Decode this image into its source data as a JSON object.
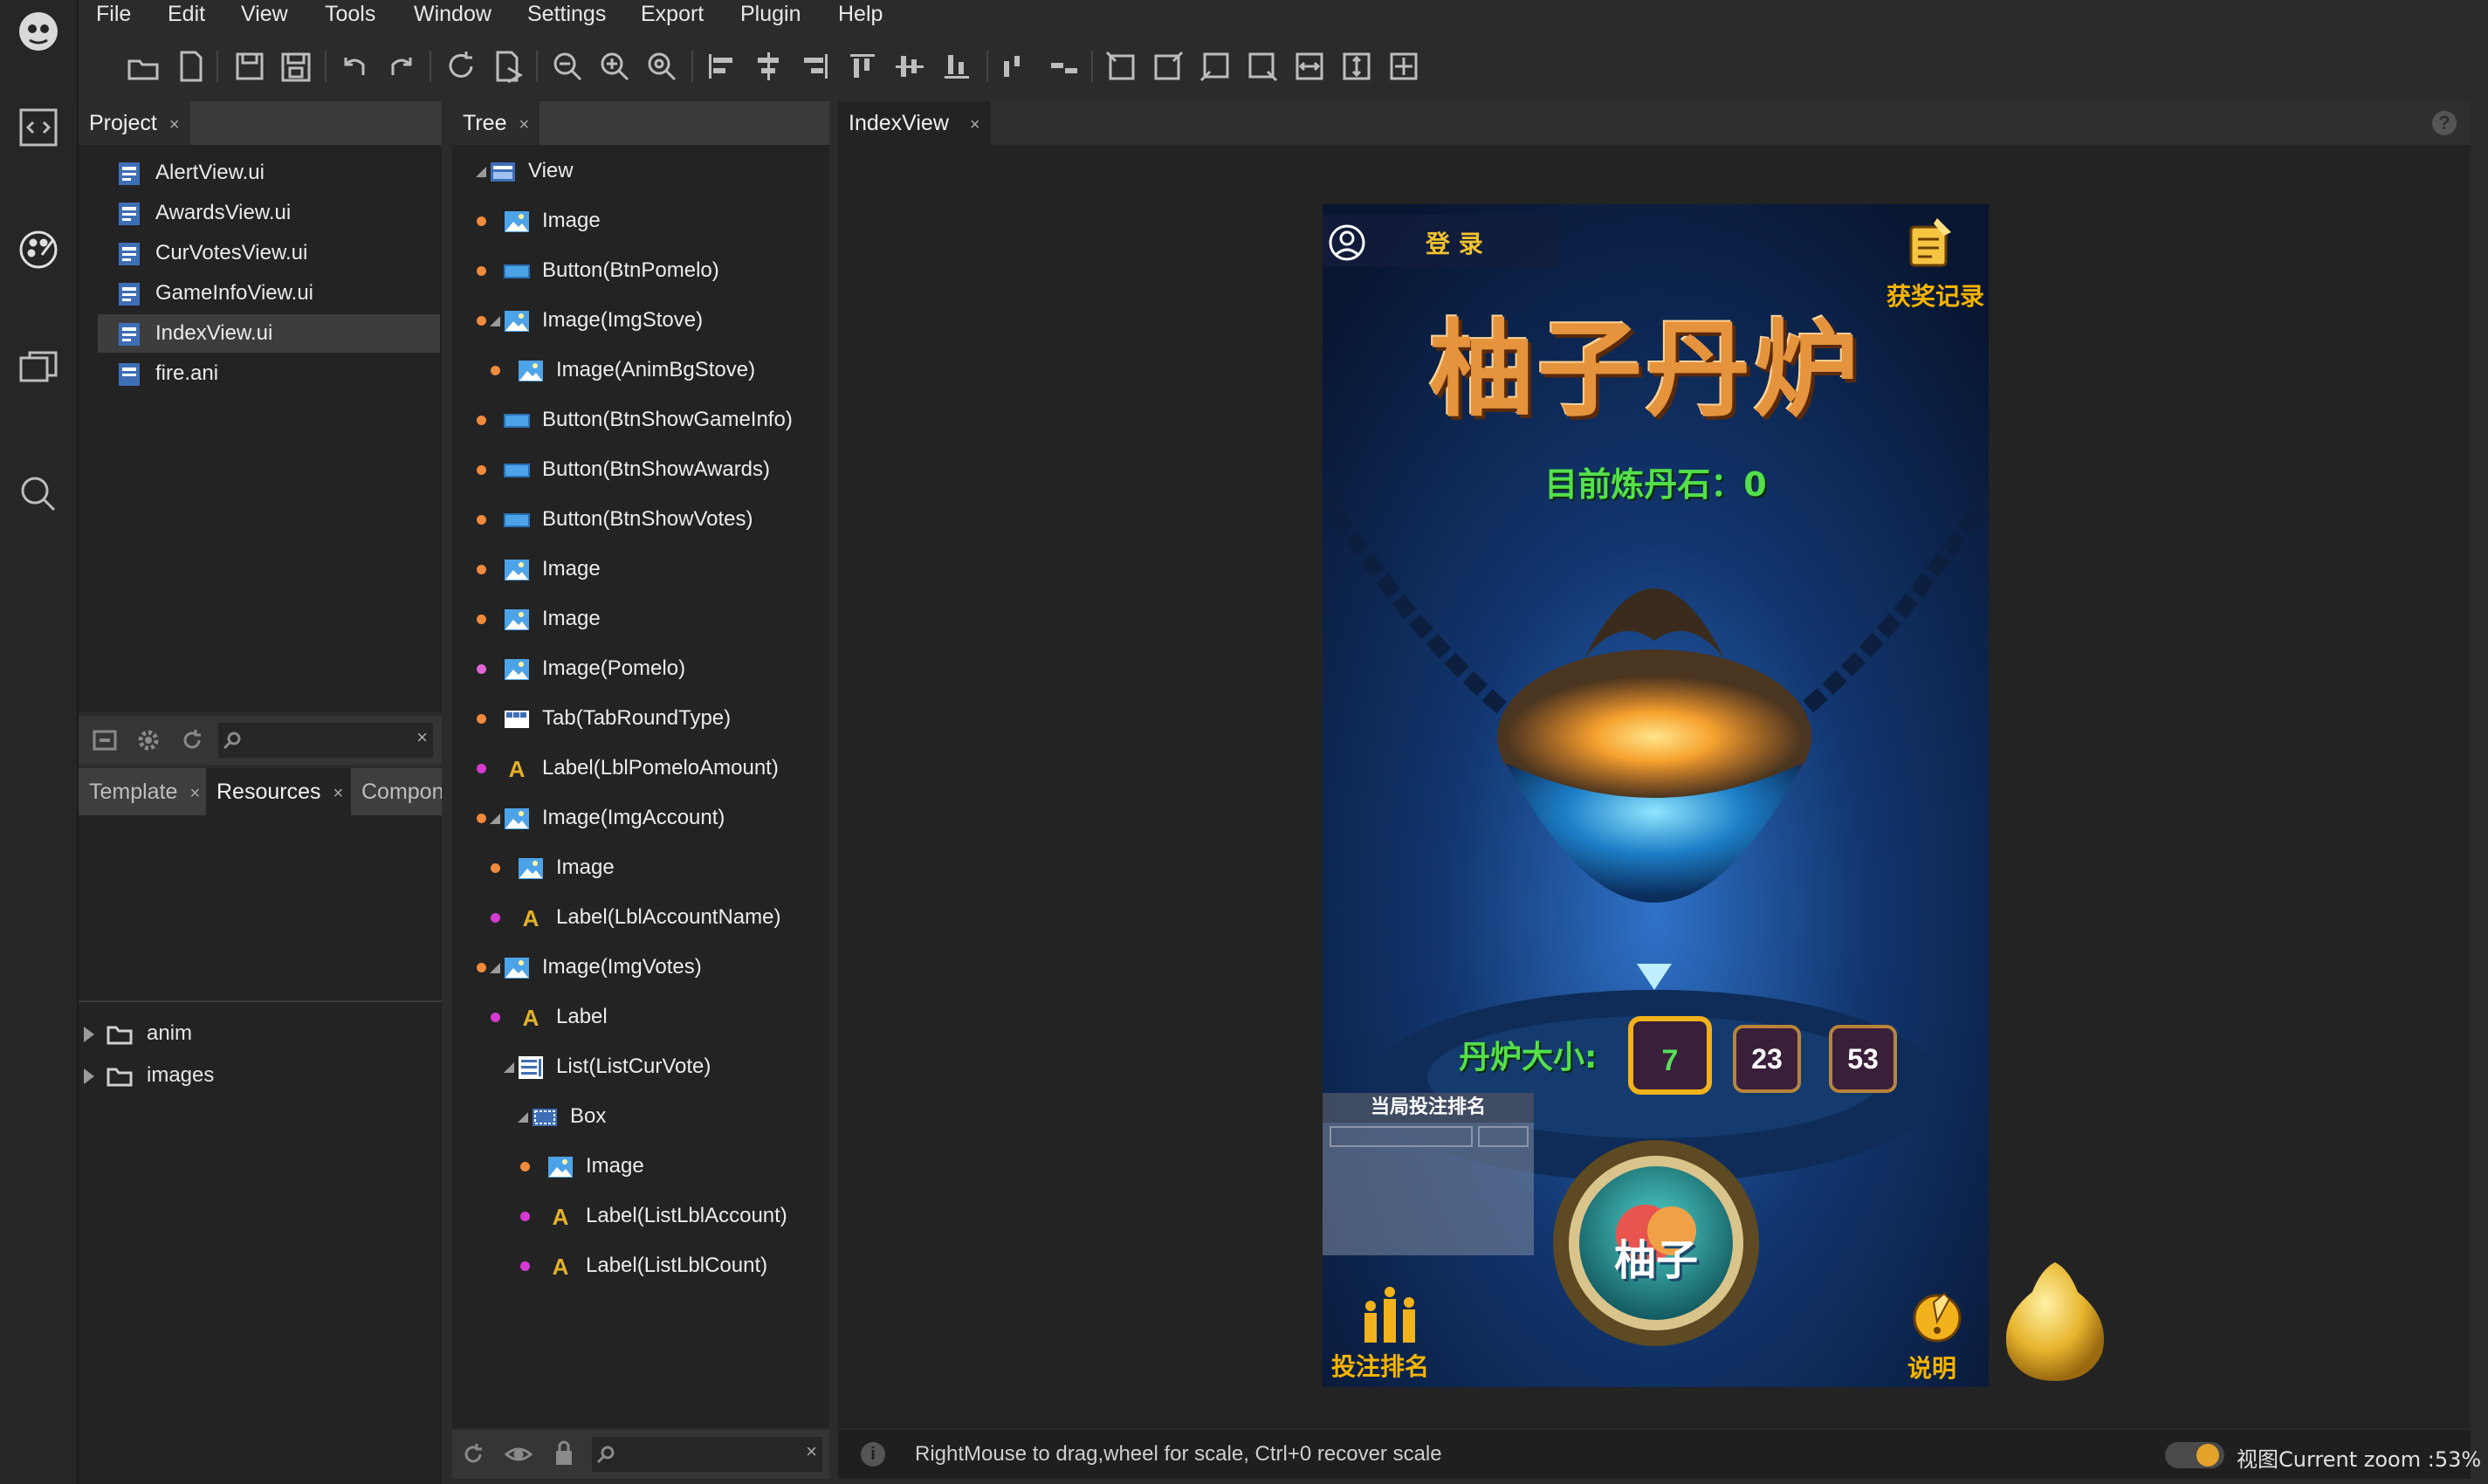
{
  "menu": [
    "File",
    "Edit",
    "View",
    "Tools",
    "Window",
    "Settings",
    "Export",
    "Plugin",
    "Help"
  ],
  "project": {
    "tab": "Project",
    "files": [
      "AlertView.ui",
      "AwardsView.ui",
      "CurVotesView.ui",
      "GameInfoView.ui",
      "IndexView.ui",
      "fire.ani"
    ],
    "selected": "IndexView.ui"
  },
  "bottom_tabs": [
    "Template",
    "Resources",
    "Compone"
  ],
  "resources": {
    "folders": [
      "anim",
      "images"
    ]
  },
  "tree": {
    "tab": "Tree",
    "items": [
      {
        "label": "View",
        "type": "view",
        "depth": 0,
        "expand": true,
        "dot": ""
      },
      {
        "label": "Image",
        "type": "image",
        "depth": 1,
        "dot": "#f08a3c"
      },
      {
        "label": "Button(BtnPomelo)",
        "type": "button",
        "depth": 1,
        "dot": "#f08a3c"
      },
      {
        "label": "Image(ImgStove)",
        "type": "image",
        "depth": 1,
        "expand": true,
        "dot": "#f08a3c"
      },
      {
        "label": "Image(AnimBgStove)",
        "type": "image",
        "depth": 2,
        "dot": "#f08a3c"
      },
      {
        "label": "Button(BtnShowGameInfo)",
        "type": "button",
        "depth": 1,
        "dot": "#f08a3c"
      },
      {
        "label": "Button(BtnShowAwards)",
        "type": "button",
        "depth": 1,
        "dot": "#f08a3c"
      },
      {
        "label": "Button(BtnShowVotes)",
        "type": "button",
        "depth": 1,
        "dot": "#f08a3c"
      },
      {
        "label": "Image",
        "type": "image",
        "depth": 1,
        "dot": "#f08a3c"
      },
      {
        "label": "Image",
        "type": "image",
        "depth": 1,
        "dot": "#f08a3c"
      },
      {
        "label": "Image(Pomelo)",
        "type": "image",
        "depth": 1,
        "dot": "#e066d6"
      },
      {
        "label": "Tab(TabRoundType)",
        "type": "tab",
        "depth": 1,
        "dot": "#f08a3c"
      },
      {
        "label": "Label(LblPomeloAmount)",
        "type": "label",
        "depth": 1,
        "dot": "#d63bd1"
      },
      {
        "label": "Image(ImgAccount)",
        "type": "image",
        "depth": 1,
        "expand": true,
        "dot": "#f08a3c"
      },
      {
        "label": "Image",
        "type": "image",
        "depth": 2,
        "dot": "#f08a3c"
      },
      {
        "label": "Label(LblAccountName)",
        "type": "label",
        "depth": 2,
        "dot": "#d63bd1"
      },
      {
        "label": "Image(ImgVotes)",
        "type": "image",
        "depth": 1,
        "expand": true,
        "dot": "#f08a3c"
      },
      {
        "label": "Label",
        "type": "label",
        "depth": 2,
        "dot": "#d63bd1"
      },
      {
        "label": "List(ListCurVote)",
        "type": "list",
        "depth": 2,
        "expand": true,
        "dot": ""
      },
      {
        "label": "Box",
        "type": "box",
        "depth": 3,
        "expand": true,
        "dot": ""
      },
      {
        "label": "Image",
        "type": "image",
        "depth": 4,
        "dot": "#f08a3c"
      },
      {
        "label": "Label(ListLblAccount)",
        "type": "label",
        "depth": 4,
        "dot": "#d63bd1"
      },
      {
        "label": "Label(ListLblCount)",
        "type": "label",
        "depth": 4,
        "dot": "#d63bd1"
      }
    ]
  },
  "editor": {
    "tab": "IndexView",
    "status": "RightMouse to drag,wheel for scale, Ctrl+0 recover scale",
    "zoom": "视图Current zoom :53%"
  },
  "game": {
    "login": "登  录",
    "awards": "获奖记录",
    "title": "柚子丹炉",
    "stones": "目前炼丹石：0",
    "size_label": "丹炉大小:",
    "sizes": [
      "7",
      "23",
      "53"
    ],
    "ranking_title": "当局投注排名",
    "pomelo_button": "柚子",
    "bet_ranking": "投注排名",
    "help": "说明"
  },
  "colors": {
    "accent": "#e3a22a",
    "bg": "#2b2b2b",
    "panel": "#232323"
  }
}
